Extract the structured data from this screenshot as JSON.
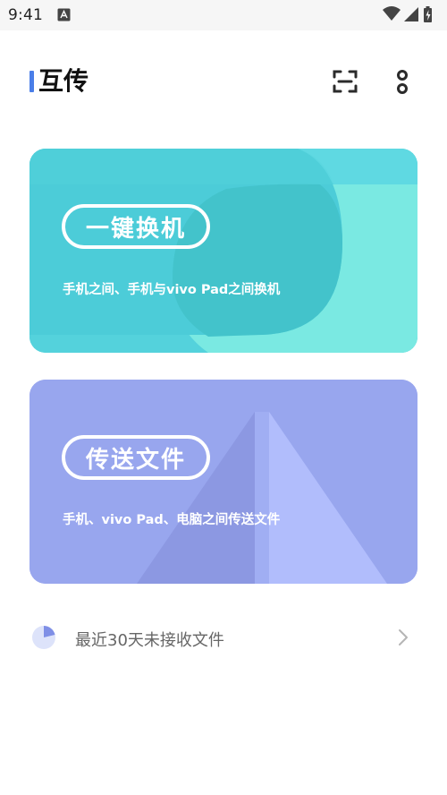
{
  "status_bar": {
    "time": "9:41"
  },
  "header": {
    "title": "互传"
  },
  "cards": [
    {
      "button_label": "一键换机",
      "description": "手机之间、手机与vivo Pad之间换机",
      "color": "#54d2dc"
    },
    {
      "button_label": "传送文件",
      "description": "手机、vivo Pad、电脑之间传送文件",
      "color": "#98a6ee"
    }
  ],
  "recent": {
    "label": "最近30天未接收文件"
  },
  "colors": {
    "accent": "#4a7ee8",
    "title": "#111111",
    "recent_text": "#666666"
  }
}
